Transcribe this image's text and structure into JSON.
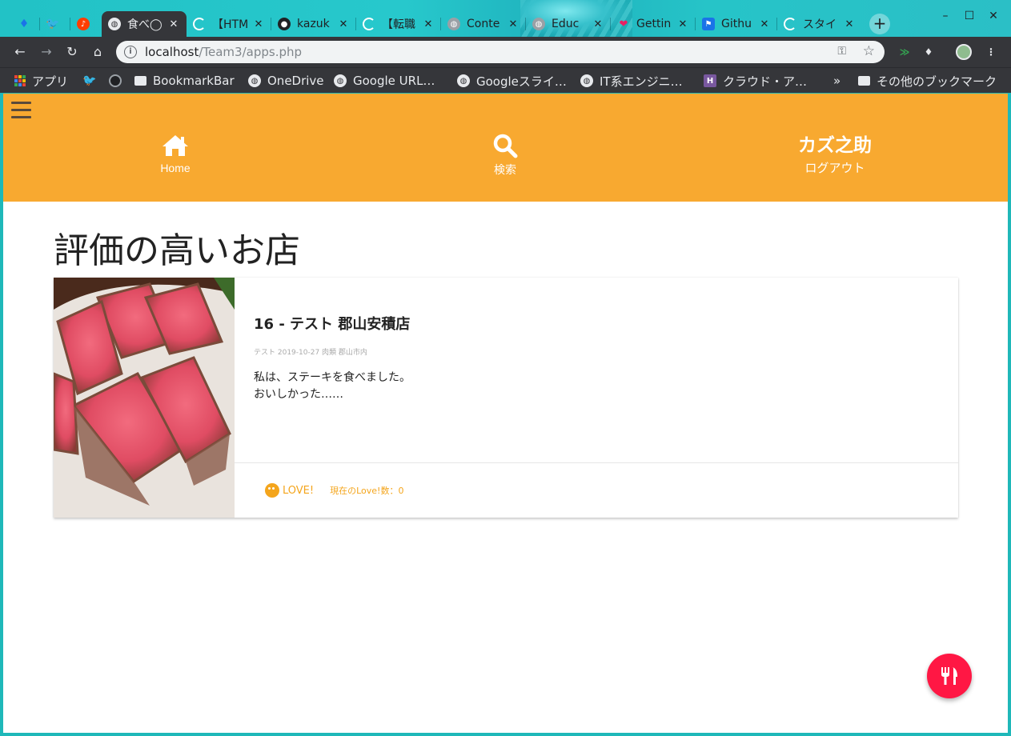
{
  "browser": {
    "tabs": [
      {
        "title": "",
        "favicon": "diamond-icon",
        "favicon_color": "#1a73e8",
        "active": false
      },
      {
        "title": "",
        "favicon": "twitter-bird-icon",
        "favicon_color": "#1da1f2",
        "active": false
      },
      {
        "title": "",
        "favicon": "music-note-icon",
        "favicon_color": "#ff3d00",
        "active": false
      },
      {
        "title": "食べ◯",
        "favicon": "globe-icon",
        "favicon_color": "#e8eaed",
        "active": true
      },
      {
        "title": "【HTM",
        "favicon": "loading-spinner-icon",
        "favicon_color": "#ffffff",
        "active": false
      },
      {
        "title": "kazuk",
        "favicon": "github-icon",
        "favicon_color": "#202124",
        "active": false
      },
      {
        "title": "【転職",
        "favicon": "loading-spinner-icon",
        "favicon_color": "#ffffff",
        "active": false
      },
      {
        "title": "Conte",
        "favicon": "globe-icon",
        "favicon_color": "#5f6368",
        "active": false
      },
      {
        "title": "Educ",
        "favicon": "globe-icon",
        "favicon_color": "#5f6368",
        "active": false
      },
      {
        "title": "Gettin",
        "favicon": "heart-icon",
        "favicon_color": "#e91e63",
        "active": false
      },
      {
        "title": "Githu",
        "favicon": "flag-icon",
        "favicon_color": "#1a73e8",
        "active": false
      },
      {
        "title": "スタイ",
        "favicon": "loading-spinner-icon",
        "favicon_color": "#ffffff",
        "active": false
      }
    ],
    "new_tab_label": "+",
    "window_controls": {
      "minimize": "–",
      "maximize": "☐",
      "close": "✕"
    },
    "url": {
      "host": "localhost",
      "path": "/Team3/apps.php"
    },
    "bookmarks": [
      {
        "label": "アプリ",
        "icon": "apps-grid-icon"
      },
      {
        "label": "",
        "icon": "twitter-bird-icon"
      },
      {
        "label": "",
        "icon": "github-icon"
      },
      {
        "label": "BookmarkBar",
        "icon": "folder-icon"
      },
      {
        "label": "OneDrive",
        "icon": "globe-icon"
      },
      {
        "label": "Google URL…",
        "icon": "globe-icon"
      },
      {
        "label": "Googleスライ…",
        "icon": "globe-icon"
      },
      {
        "label": "IT系エンジニ…",
        "icon": "globe-icon"
      },
      {
        "label": "クラウド・ア…",
        "icon": "heroku-icon"
      }
    ],
    "bookmarks_overflow": "»",
    "other_bookmarks": "その他のブックマーク"
  },
  "app": {
    "brand_color": "#f8a930",
    "nav": {
      "home_label": "Home",
      "search_label": "検索",
      "user_name": "カズ之助",
      "logout_label": "ログアウト"
    },
    "page_title": "評価の高いお店",
    "cards": [
      {
        "title": "16 - テスト 郡山安積店",
        "meta": "テスト 2019-10-27 肉類 郡山市内",
        "text_line1": "私は、ステーキを食べました。",
        "text_line2": "おいしかった……",
        "love_label": "LOVE!",
        "love_count": "現在のLove!数：0",
        "image": "steak-photo"
      }
    ],
    "fab_icon": "fork-knife-icon",
    "fab_color": "#ff1744"
  }
}
